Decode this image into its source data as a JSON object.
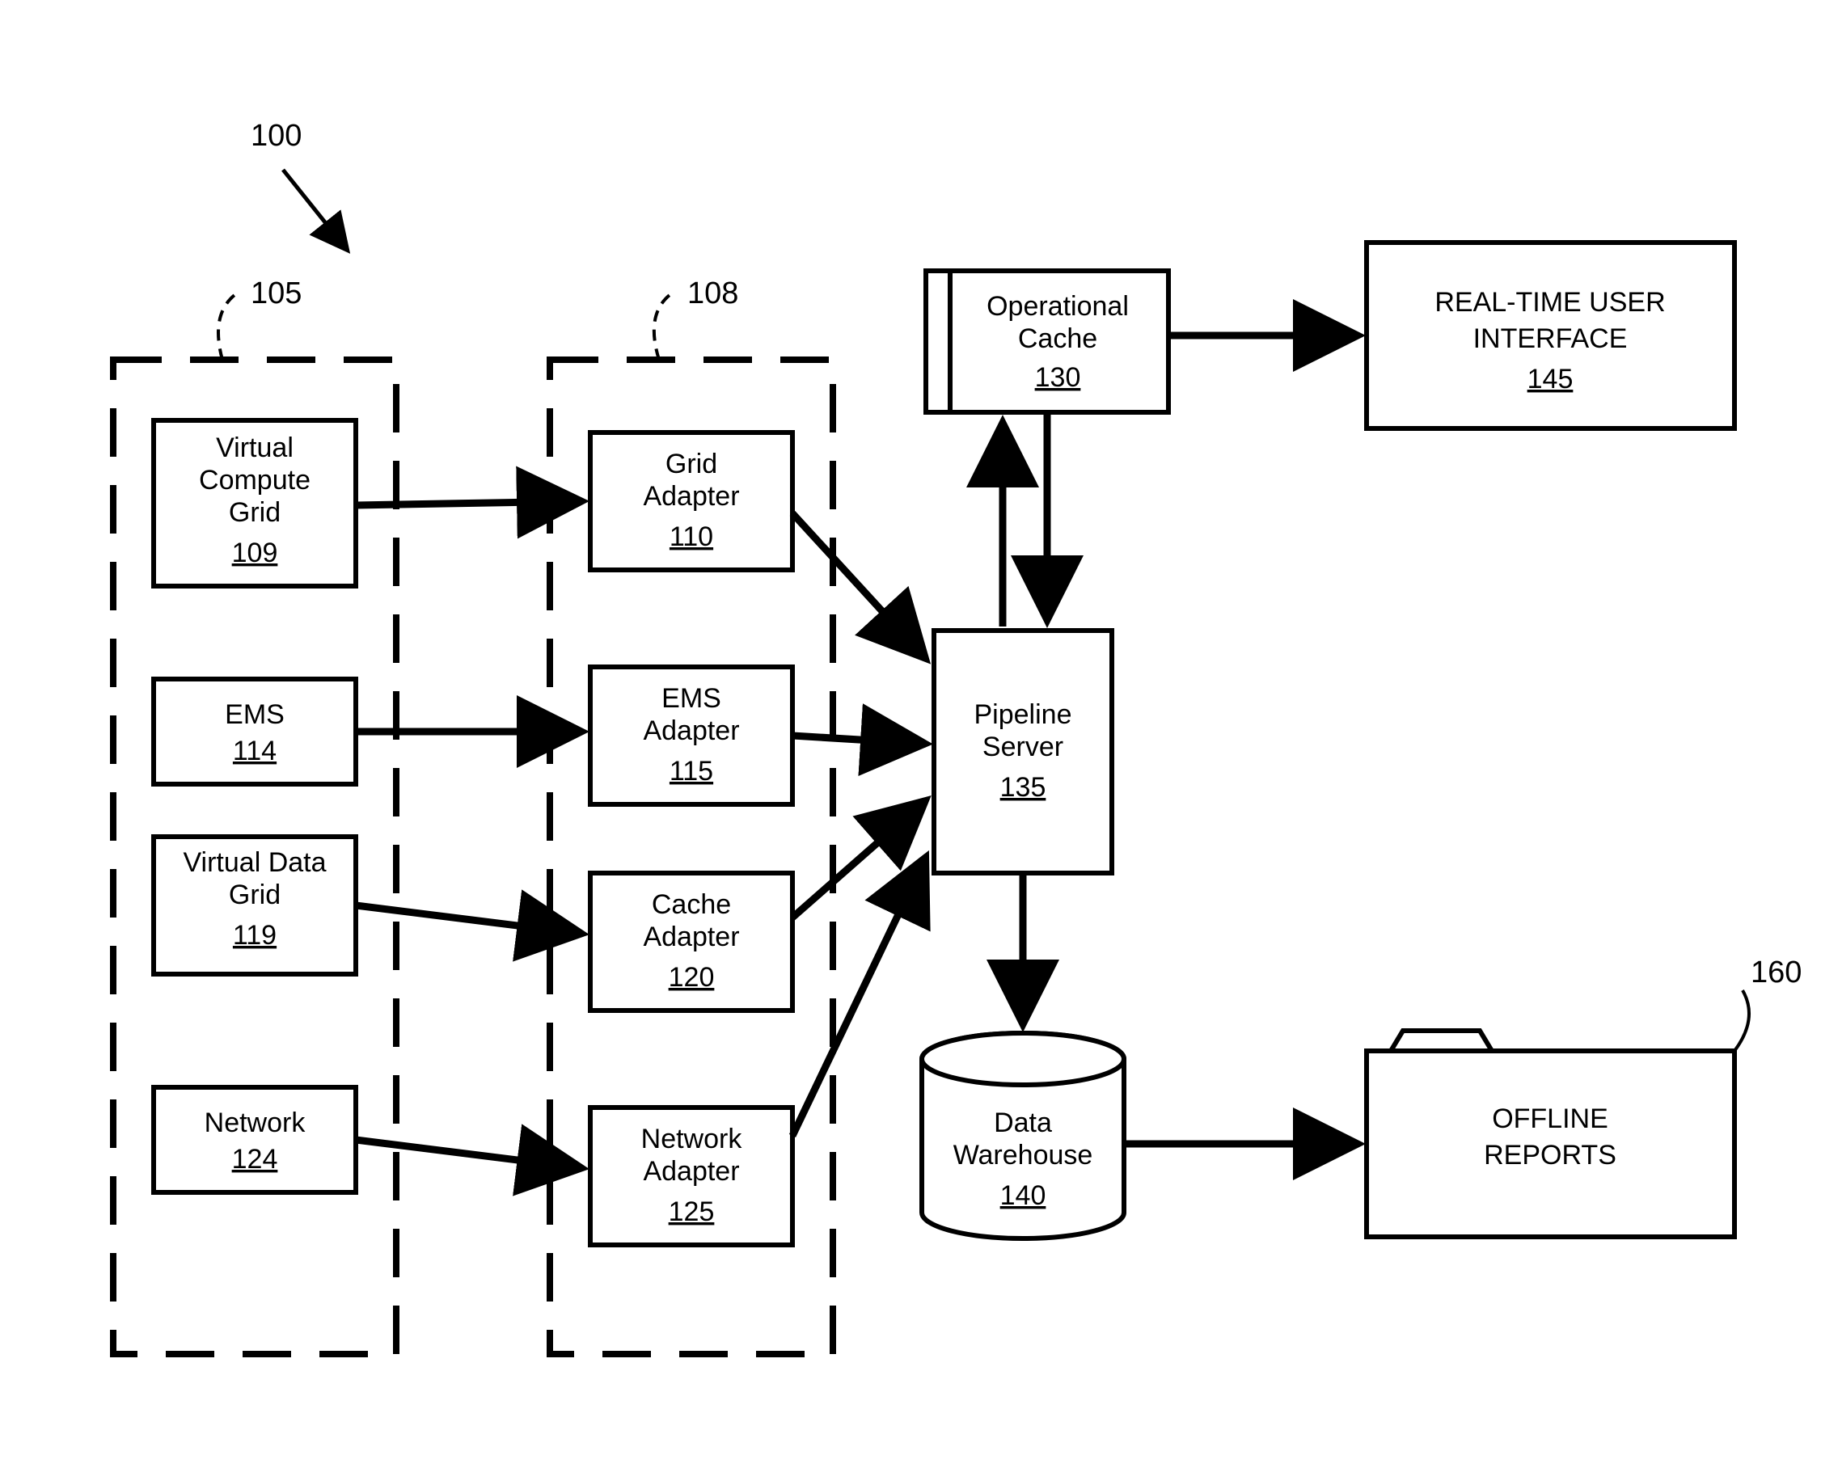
{
  "diagram": {
    "figure_label": "100",
    "group_labels": {
      "sources": "105",
      "adapters": "108",
      "reports_folder": "160"
    },
    "nodes": {
      "vcg": {
        "title": "Virtual Compute Grid",
        "ref": "109"
      },
      "ems": {
        "title": "EMS",
        "ref": "114"
      },
      "vdg": {
        "title": "Virtual Data Grid",
        "ref": "119"
      },
      "net": {
        "title": "Network",
        "ref": "124"
      },
      "grid_ad": {
        "title": "Grid Adapter",
        "ref": "110"
      },
      "ems_ad": {
        "title": "EMS Adapter",
        "ref": "115"
      },
      "cache_ad": {
        "title": "Cache Adapter",
        "ref": "120"
      },
      "net_ad": {
        "title": "Network Adapter",
        "ref": "125"
      },
      "pipe": {
        "title": "Pipeline Server",
        "ref": "135"
      },
      "opcache": {
        "title": "Operational Cache",
        "ref": "130"
      },
      "dw": {
        "title": "Data Warehouse",
        "ref": "140"
      },
      "rtui": {
        "title": "REAL-TIME USER INTERFACE",
        "ref": "145"
      },
      "reports": {
        "title": "OFFLINE REPORTS"
      }
    }
  }
}
